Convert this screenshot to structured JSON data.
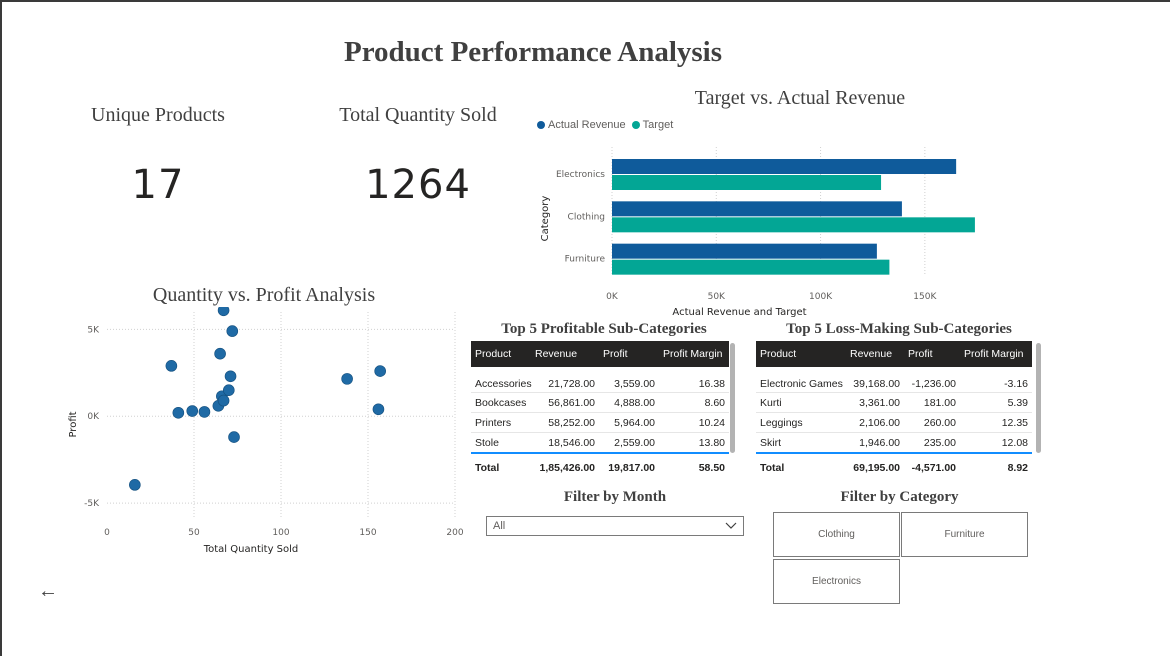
{
  "page": {
    "title": "Product Performance Analysis"
  },
  "cards": [
    {
      "label": "Unique Products",
      "value": "17"
    },
    {
      "label": "Total Quantity Sold",
      "value": "1264"
    }
  ],
  "bar_chart": {
    "title": "Target vs. Actual Revenue",
    "legend": [
      "Actual Revenue",
      "Target"
    ],
    "colors": [
      "#0f5b9b",
      "#03a695"
    ],
    "xlabel": "Actual Revenue and Target",
    "ylabel": "Category"
  },
  "scatter_chart": {
    "title": "Quantity vs. Profit Analysis",
    "xlabel": "Total Quantity Sold",
    "ylabel": "Profit",
    "color": "#1f6aa5"
  },
  "chart_data": [
    {
      "type": "bar",
      "orientation": "horizontal",
      "title": "Target vs. Actual Revenue",
      "categories": [
        "Electronics",
        "Clothing",
        "Furniture"
      ],
      "series": [
        {
          "name": "Actual Revenue",
          "values": [
            165000,
            139000,
            127000
          ]
        },
        {
          "name": "Target",
          "values": [
            129000,
            174000,
            133000
          ]
        }
      ],
      "xlabel": "Actual Revenue and Target",
      "ylabel": "Category",
      "xlim": [
        0,
        175000
      ],
      "xticks": [
        0,
        50000,
        100000,
        150000
      ],
      "xtick_labels": [
        "0K",
        "50K",
        "100K",
        "150K"
      ],
      "grid": true,
      "legend": "top-left"
    },
    {
      "type": "scatter",
      "title": "Quantity vs. Profit Analysis",
      "xlabel": "Total Quantity Sold",
      "ylabel": "Profit",
      "xlim": [
        0,
        200
      ],
      "ylim": [
        -5800,
        6000
      ],
      "xticks": [
        0,
        50,
        100,
        150,
        200
      ],
      "xtick_labels": [
        "0",
        "50",
        "100",
        "150",
        "200"
      ],
      "yticks": [
        -5000,
        0,
        5000
      ],
      "ytick_labels": [
        "-5K",
        "0K",
        "5K"
      ],
      "grid": true,
      "points": [
        {
          "x": 16,
          "y": -3950
        },
        {
          "x": 37,
          "y": 2900
        },
        {
          "x": 41,
          "y": 200
        },
        {
          "x": 49,
          "y": 300
        },
        {
          "x": 56,
          "y": 250
        },
        {
          "x": 64,
          "y": 600
        },
        {
          "x": 65,
          "y": 3600
        },
        {
          "x": 66,
          "y": 1150
        },
        {
          "x": 67,
          "y": 900
        },
        {
          "x": 67,
          "y": 6100
        },
        {
          "x": 70,
          "y": 1500
        },
        {
          "x": 71,
          "y": 2300
        },
        {
          "x": 72,
          "y": 4900
        },
        {
          "x": 73,
          "y": -1200
        },
        {
          "x": 138,
          "y": 2150
        },
        {
          "x": 156,
          "y": 400
        },
        {
          "x": 157,
          "y": 2600
        }
      ]
    }
  ],
  "profitable_table": {
    "title": "Top 5 Profitable Sub-Categories",
    "columns": [
      "Product",
      "Revenue",
      "Profit",
      "Profit Margin"
    ],
    "rows": [
      [
        "Accessories",
        "21,728.00",
        "3,559.00",
        "16.38"
      ],
      [
        "Bookcases",
        "56,861.00",
        "4,888.00",
        "8.60"
      ],
      [
        "Printers",
        "58,252.00",
        "5,964.00",
        "10.24"
      ],
      [
        "Stole",
        "18,546.00",
        "2,559.00",
        "13.80"
      ]
    ],
    "total": [
      "Total",
      "1,85,426.00",
      "19,817.00",
      "58.50"
    ]
  },
  "loss_table": {
    "title": "Top 5 Loss-Making Sub-Categories",
    "columns": [
      "Product",
      "Revenue",
      "Profit",
      "Profit Margin"
    ],
    "rows": [
      [
        "Electronic Games",
        "39,168.00",
        "-1,236.00",
        "-3.16"
      ],
      [
        "Kurti",
        "3,361.00",
        "181.00",
        "5.39"
      ],
      [
        "Leggings",
        "2,106.00",
        "260.00",
        "12.35"
      ],
      [
        "Skirt",
        "1,946.00",
        "235.00",
        "12.08"
      ]
    ],
    "total": [
      "Total",
      "69,195.00",
      "-4,571.00",
      "8.92"
    ]
  },
  "month_filter": {
    "title": "Filter by Month",
    "selected": "All",
    "icon": "chevron-down-icon"
  },
  "category_filter": {
    "title": "Filter by Category",
    "options": [
      "Clothing",
      "Furniture",
      "Electronics"
    ]
  },
  "nav": {
    "back_icon": "back-arrow-icon",
    "back_glyph": "←"
  }
}
